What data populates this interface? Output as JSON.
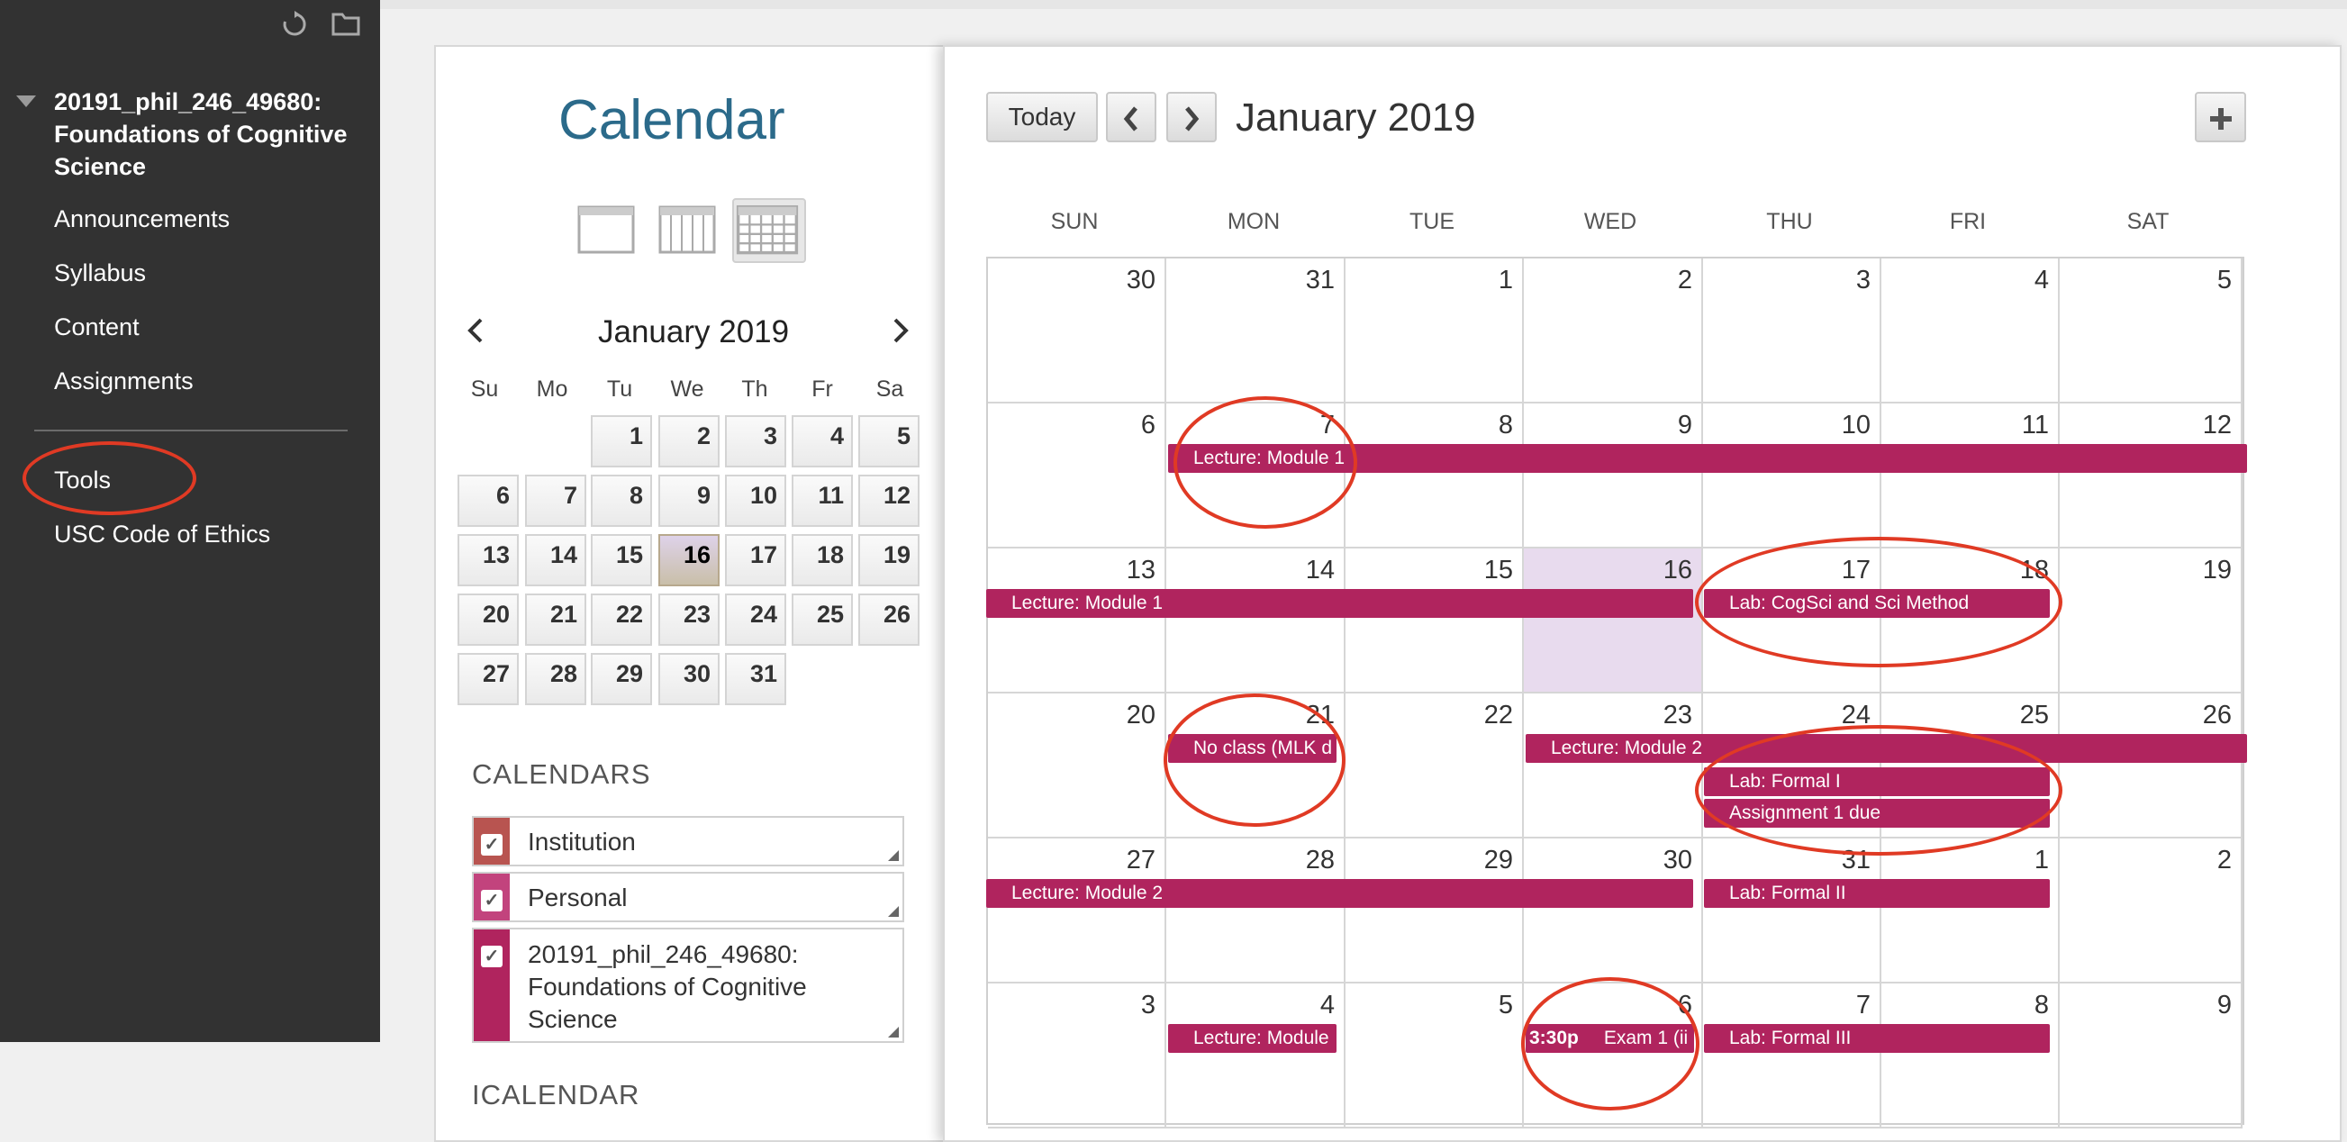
{
  "sidebar": {
    "course_title": "20191_phil_246_49680: Foundations of Cognitive Science",
    "items": [
      {
        "label": "Announcements"
      },
      {
        "label": "Syllabus"
      },
      {
        "label": "Content"
      },
      {
        "label": "Assignments"
      },
      {
        "label": "Tools"
      },
      {
        "label": "USC Code of Ethics"
      }
    ]
  },
  "left_panel": {
    "title": "Calendar",
    "views": [
      "day-view-icon",
      "week-view-icon",
      "month-view-icon"
    ],
    "mini_calendar": {
      "month_label": "January 2019",
      "weekdays": [
        "Su",
        "Mo",
        "Tu",
        "We",
        "Th",
        "Fr",
        "Sa"
      ],
      "days": [
        "1",
        "2",
        "3",
        "4",
        "5",
        "6",
        "7",
        "8",
        "9",
        "10",
        "11",
        "12",
        "13",
        "14",
        "15",
        "16",
        "17",
        "18",
        "19",
        "20",
        "21",
        "22",
        "23",
        "24",
        "25",
        "26",
        "27",
        "28",
        "29",
        "30",
        "31"
      ],
      "today": "16"
    },
    "calendars_title": "CALENDARS",
    "calendars": [
      {
        "label": "Institution",
        "color": "#b85450",
        "checked": true
      },
      {
        "label": "Personal",
        "color": "#c2437d",
        "checked": true
      },
      {
        "label": "20191_phil_246_49680: Foundations of Cognitive Science",
        "color": "#b0245e",
        "checked": true
      }
    ],
    "icalendar_title": "ICALENDAR"
  },
  "toolbar": {
    "today_label": "Today",
    "month_label": "January 2019"
  },
  "weekday_headers": [
    "SUN",
    "MON",
    "TUE",
    "WED",
    "THU",
    "FRI",
    "SAT"
  ],
  "weeks": [
    [
      "30",
      "31",
      "1",
      "2",
      "3",
      "4",
      "5"
    ],
    [
      "6",
      "7",
      "8",
      "9",
      "10",
      "11",
      "12"
    ],
    [
      "13",
      "14",
      "15",
      "16",
      "17",
      "18",
      "19"
    ],
    [
      "20",
      "21",
      "22",
      "23",
      "24",
      "25",
      "26"
    ],
    [
      "27",
      "28",
      "29",
      "30",
      "31",
      "1",
      "2"
    ],
    [
      "3",
      "4",
      "5",
      "6",
      "7",
      "8",
      "9"
    ]
  ],
  "events": [
    {
      "title": "Lecture: Module 1",
      "time": ""
    },
    {
      "title": "Lecture: Module 1",
      "time": ""
    },
    {
      "title": "Lab: CogSci and Sci Method",
      "time": ""
    },
    {
      "title": "No class (MLK d",
      "time": ""
    },
    {
      "title": "Lecture: Module 2",
      "time": ""
    },
    {
      "title": "Lab: Formal I",
      "time": ""
    },
    {
      "title": "Assignment 1 due",
      "time": ""
    },
    {
      "title": "Lecture: Module 2",
      "time": ""
    },
    {
      "title": "Lab: Formal II",
      "time": ""
    },
    {
      "title": "Lecture: Module",
      "time": ""
    },
    {
      "title": "Exam 1 (ii",
      "time": "3:30p"
    },
    {
      "title": "Lab: Formal III",
      "time": ""
    }
  ],
  "colors": {
    "event": "#b0245e",
    "highlight": "#e8dbee",
    "annotation": "#e03a24",
    "title": "#2b6a8a"
  }
}
